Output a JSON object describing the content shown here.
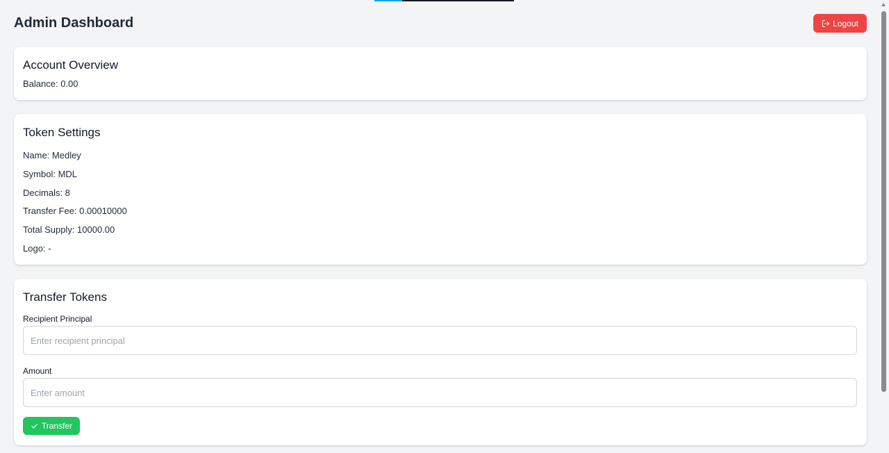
{
  "header": {
    "title": "Admin Dashboard",
    "logout_label": "Logout"
  },
  "account": {
    "title": "Account Overview",
    "balance": "Balance: 0.00"
  },
  "token": {
    "title": "Token Settings",
    "rows": [
      "Name: Medley",
      "Symbol: MDL",
      "Decimals: 8",
      "Transfer Fee: 0.00010000",
      "Total Supply: 10000.00",
      "Logo: -"
    ]
  },
  "transfer": {
    "title": "Transfer Tokens",
    "recipient_label": "Recipient Principal",
    "recipient_placeholder": "Enter recipient principal",
    "recipient_value": "",
    "amount_label": "Amount",
    "amount_placeholder": "Enter amount",
    "amount_value": "",
    "button_label": "Transfer"
  },
  "icons": {
    "logout": "logout-icon",
    "transfer": "check-icon"
  },
  "colors": {
    "logout": "#ef4444",
    "transfer": "#22c55e",
    "background": "#f3f4f6"
  }
}
